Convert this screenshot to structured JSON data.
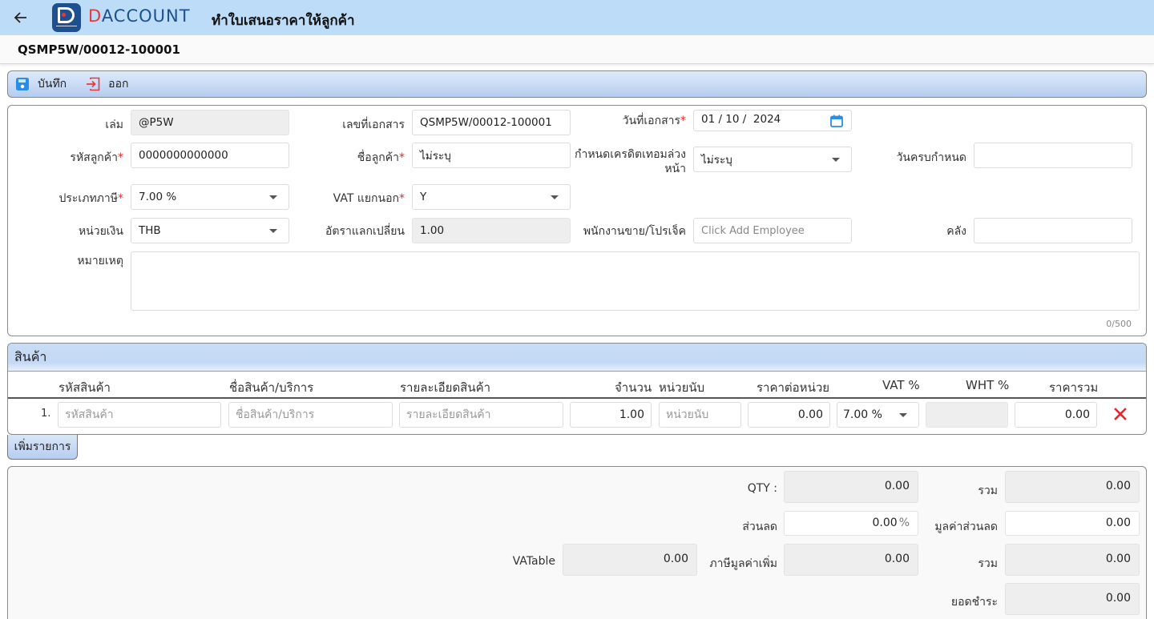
{
  "header": {
    "brand": "DACCOUNT",
    "brand_first_letter": "D",
    "brand_rest": "ACCOUNT",
    "page_title": "ทำใบเสนอราคาให้ลูกค้า",
    "doc_number": "QSMP5W/00012-100001"
  },
  "toolbar": {
    "save_label": "บันทึก",
    "exit_label": "ออก"
  },
  "form": {
    "book": {
      "label": "เล่ม",
      "value": "@P5W"
    },
    "doc_no": {
      "label": "เลขที่เอกสาร",
      "value": "QSMP5W/00012-100001"
    },
    "doc_date": {
      "label": "วันที่เอกสาร",
      "required": "*",
      "value": "01 / 10 /  2024"
    },
    "customer_code": {
      "label": "รหัสลูกค้า",
      "required": "*",
      "value": "0000000000000"
    },
    "customer_name": {
      "label": "ชื่อลูกค้า",
      "required": "*",
      "value": "ไม่ระบุ"
    },
    "credit_term": {
      "label_line1": "กำหนดเครดิตเทอมล่วง",
      "label_line2": "หน้า",
      "value": "ไม่ระบุ"
    },
    "due_date": {
      "label": "วันครบกำหนด",
      "value": ""
    },
    "tax_type": {
      "label": "ประเภทภาษี",
      "required": "*",
      "value": "7.00 %"
    },
    "vat_separate": {
      "label": "VAT แยกนอก",
      "required": "*",
      "value": "Y"
    },
    "currency": {
      "label": "หน่วยเงิน",
      "value": "THB"
    },
    "exchange_rate": {
      "label": "อัตราแลกเปลี่ยน",
      "value": "1.00"
    },
    "salesperson": {
      "label": "พนักงานขาย/โปรเจ็ค",
      "placeholder": "Click Add Employee"
    },
    "warehouse": {
      "label": "คลัง",
      "value": ""
    },
    "remark": {
      "label": "หมายเหตุ",
      "value": "",
      "counter": "0/500"
    }
  },
  "products": {
    "title": "สินค้า",
    "columns": [
      "รหัสสินค้า",
      "ชื่อสินค้า/บริการ",
      "รายละเอียดสินค้า",
      "จำนวน",
      "หน่วยนับ",
      "ราคาต่อหน่วย",
      "VAT %",
      "WHT %",
      "ราคารวม"
    ],
    "rows": [
      {
        "no": "1.",
        "code_placeholder": "รหัสสินค้า",
        "name_placeholder": "ชื่อสินค้า/บริการ",
        "detail_placeholder": "รายละเอียดสินค้า",
        "qty": "1.00",
        "unit_placeholder": "หน่วยนับ",
        "unit_price": "0.00",
        "vat": "7.00 %",
        "wht": "",
        "total": "0.00"
      }
    ],
    "add_button": "เพิ่มรายการ"
  },
  "summary": {
    "qty_label": "QTY :",
    "qty_value": "0.00",
    "sum_label": "รวม",
    "sum_value": "0.00",
    "discount_label": "ส่วนลด",
    "discount_value": "0.00",
    "discount_unit": "%",
    "discount_amount_label": "มูลค่าส่วนลด",
    "discount_amount_value": "0.00",
    "vatable_label": "VATable",
    "vatable_value": "0.00",
    "vat_label": "ภาษีมูลค่าเพิ่ม",
    "vat_value": "0.00",
    "total_label": "รวม",
    "total_value": "0.00",
    "grand_label": "ยอดชำระ",
    "grand_value": "0.00"
  },
  "colors": {
    "header_bg": "#bcdcf8",
    "brand_blue": "#1e4f8e",
    "brand_red": "#e5393a",
    "required_red": "#d9302b",
    "save_icon": "#2a8de6",
    "exit_icon": "#e5393a"
  },
  "icons": {
    "back": "arrow-left-icon",
    "save": "floppy-disk-icon",
    "exit": "sign-out-icon",
    "calendar": "calendar-icon",
    "delete": "close-x-icon",
    "dropdown": "caret-down-icon"
  }
}
